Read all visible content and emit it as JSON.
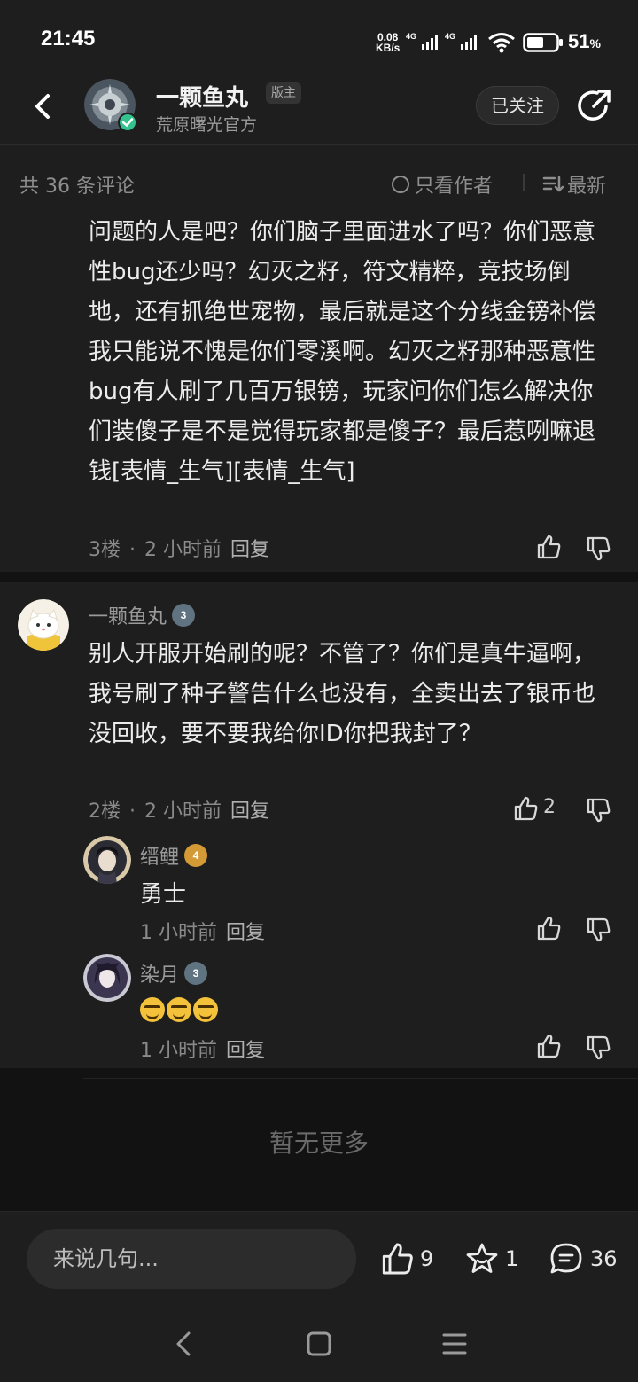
{
  "status_bar": {
    "time": "21:45",
    "net_speed_value": "0.08",
    "net_speed_unit": "KB/s",
    "battery_pct": "51",
    "battery_unit": "%",
    "signal_label": "4G"
  },
  "header": {
    "name": "一颗鱼丸",
    "badge": "版主",
    "subtitle": "荒原曙光官方",
    "follow_label": "已关注"
  },
  "sort_bar": {
    "comment_count": "共 36 条评论",
    "author_only": "只看作者",
    "sort_newest": "最新"
  },
  "comment_3": {
    "text": "问题的人是吧？你们脑子里面进水了吗？你们恶意性bug还少吗？幻灭之籽，符文精粹，竞技场倒地，还有抓绝世宠物，最后就是这个分线金镑补偿我只能说不愧是你们零溪啊。幻灭之籽那种恶意性bug有人刷了几百万银镑，玩家问你们怎么解决你们装傻子是不是觉得玩家都是傻子？最后惹咧嘛退钱[表情_生气][表情_生气]",
    "floor": "3楼",
    "time": "2 小时前",
    "reply": "回复"
  },
  "comment_2": {
    "author": "一颗鱼丸",
    "level": "3",
    "text": "别人开服开始刷的呢？不管了？你们是真牛逼啊，我号刷了种子警告什么也没有，全卖出去了银币也没回收，要不要我给你ID你把我封了？",
    "floor": "2楼",
    "time": "2 小时前",
    "reply": "回复",
    "likes": "2"
  },
  "reply_1": {
    "author": "缙鲤",
    "level": "4",
    "text": "勇士",
    "time": "1 小时前",
    "reply": "回复"
  },
  "reply_2": {
    "author": "染月",
    "level": "3",
    "time": "1 小时前",
    "reply": "回复"
  },
  "no_more": "暂无更多",
  "bottom_bar": {
    "input_placeholder": "来说几句...",
    "likes": "9",
    "favorites": "1",
    "comments": "36"
  },
  "colors": {
    "background": "#1e1e1e",
    "verified": "#34c38f",
    "level_badge": "#5f7380",
    "level_badge_gold": "#d49a36"
  },
  "icons": [
    "back-icon",
    "share-icon",
    "thumb-up-icon",
    "thumb-down-icon",
    "star-icon",
    "comment-icon",
    "nav-back-icon",
    "nav-home-icon",
    "nav-menu-icon",
    "wifi-icon",
    "battery-icon",
    "signal-icon"
  ]
}
